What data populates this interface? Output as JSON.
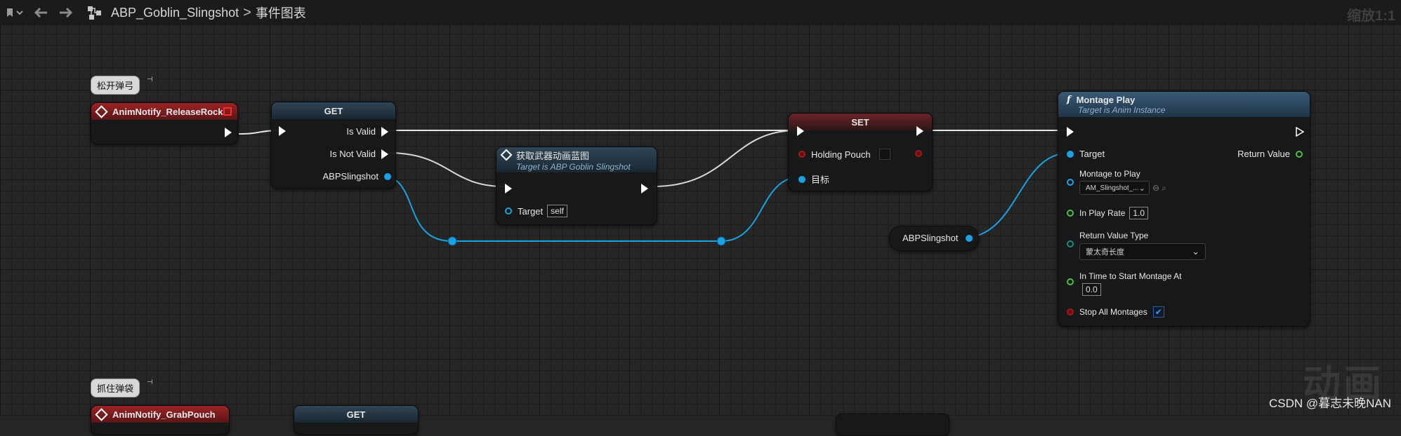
{
  "toolbar": {
    "breadcrumb_blueprint": "ABP_Goblin_Slingshot",
    "breadcrumb_separator": ">",
    "breadcrumb_graph": "事件图表",
    "zoom": "缩放1:1"
  },
  "comments": {
    "release": "松开弹弓",
    "grab": "抓住弹袋"
  },
  "notify_release": {
    "title": "AnimNotify_ReleaseRock"
  },
  "notify_grab": {
    "title": "AnimNotify_GrabPouch"
  },
  "get_node": {
    "title": "GET",
    "is_valid": "Is Valid",
    "is_not_valid": "Is Not Valid",
    "output": "ABPSlingshot"
  },
  "get_node_2": {
    "title": "GET"
  },
  "cast_node": {
    "title": "获取武器动画蓝图",
    "subtitle": "Target is ABP Goblin Slingshot",
    "target_label": "Target",
    "target_value": "self"
  },
  "set_node": {
    "title": "SET",
    "holding_pouch": "Holding Pouch",
    "target_label": "目标"
  },
  "var_node": {
    "label": "ABPSlingshot"
  },
  "montage_node": {
    "title": "Montage Play",
    "subtitle": "Target is Anim Instance",
    "target": "Target",
    "return_value": "Return Value",
    "montage_to_play": "Montage to Play",
    "montage_asset": "AM_Slingshot_...",
    "in_play_rate": "In Play Rate",
    "play_rate_value": "1.0",
    "return_value_type": "Return Value Type",
    "return_type_option": "蒙太奇长度",
    "in_time_to_start": "In Time to Start Montage At",
    "start_time_value": "0.0",
    "stop_all_montages": "Stop All Montages"
  },
  "watermark": {
    "big": "动画",
    "csdn": "CSDN @暮志未晚NAN"
  },
  "colors": {
    "exec": "#ffffff",
    "object_pin": "#19a2e4",
    "float_pin": "#4cc23b",
    "bool_pin": "#a41818",
    "notify_header": "#9d2426"
  }
}
